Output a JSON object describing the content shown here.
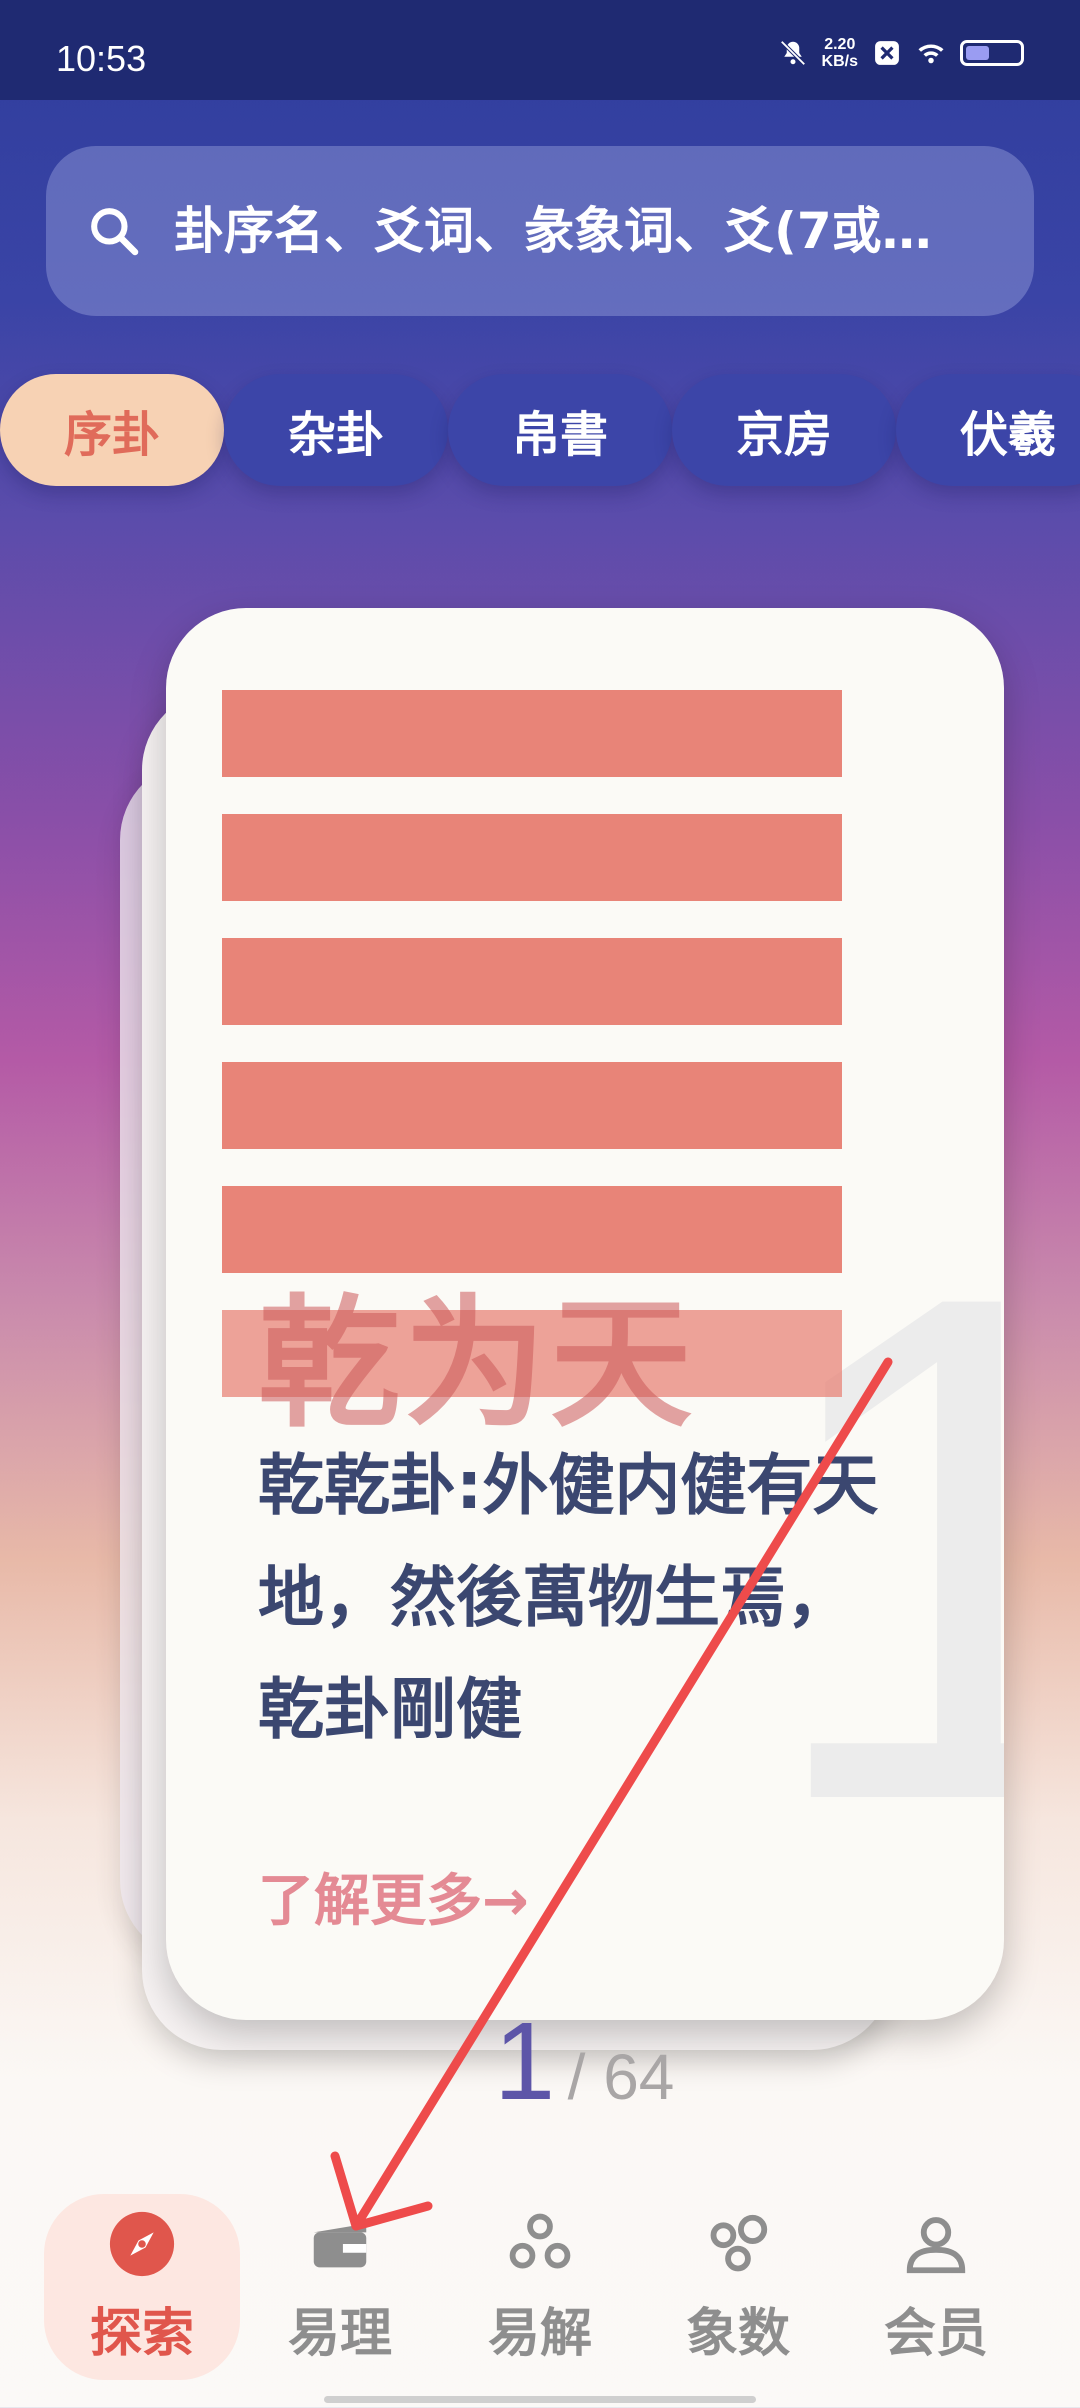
{
  "status_bar": {
    "time": "10:53",
    "net_speed_value": "2.20",
    "net_speed_unit": "KB/s",
    "icons": [
      "mute-bell-icon",
      "x-app-icon",
      "wifi-icon",
      "battery-icon"
    ]
  },
  "search": {
    "placeholder": "卦序名、爻词、彖象词、爻(7或…"
  },
  "tabs": [
    {
      "label": "序卦",
      "active": true
    },
    {
      "label": "杂卦",
      "active": false
    },
    {
      "label": "帛書",
      "active": false
    },
    {
      "label": "京房",
      "active": false
    },
    {
      "label": "伏羲",
      "active": false
    }
  ],
  "card": {
    "number": "1",
    "name": "乾为天",
    "description": "乾乾卦:外健内健有天地，然後萬物生焉，乾卦剛健",
    "more_link": "了解更多→",
    "hexagram_lines": [
      "yang",
      "yang",
      "yang",
      "yang",
      "yang",
      "yang"
    ],
    "line_color": "#e88478"
  },
  "pager": {
    "current": "1",
    "total": "/ 64"
  },
  "bottom_nav": [
    {
      "label": "探索",
      "icon": "compass-icon",
      "active": true
    },
    {
      "label": "易理",
      "icon": "book-icon",
      "active": false
    },
    {
      "label": "易解",
      "icon": "three-circles-icon",
      "active": false
    },
    {
      "label": "象数",
      "icon": "bubbles-icon",
      "active": false
    },
    {
      "label": "会员",
      "icon": "user-icon",
      "active": false
    }
  ]
}
